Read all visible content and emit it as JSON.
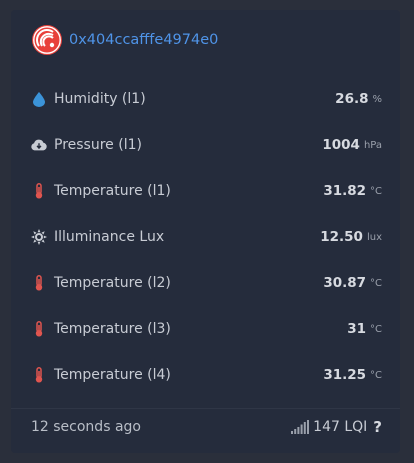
{
  "device": {
    "ieee": "0x404ccafffe4974e0",
    "logo_icon": "espressif-logo-icon"
  },
  "readings": [
    {
      "icon": "water-drop-icon",
      "label": "Humidity (l1)",
      "value": "26.8",
      "unit": "%"
    },
    {
      "icon": "cloud-download-icon",
      "label": "Pressure (l1)",
      "value": "1004",
      "unit": "hPa"
    },
    {
      "icon": "thermometer-icon",
      "label": "Temperature (l1)",
      "value": "31.82",
      "unit": "°C"
    },
    {
      "icon": "sun-icon",
      "label": "Illuminance Lux",
      "value": "12.50",
      "unit": "lux"
    },
    {
      "icon": "thermometer-icon",
      "label": "Temperature (l2)",
      "value": "30.87",
      "unit": "°C"
    },
    {
      "icon": "thermometer-icon",
      "label": "Temperature (l3)",
      "value": "31",
      "unit": "°C"
    },
    {
      "icon": "thermometer-icon",
      "label": "Temperature (l4)",
      "value": "31.25",
      "unit": "°C"
    }
  ],
  "footer": {
    "last_seen": "12 seconds ago",
    "lqi": "147 LQI",
    "help": "?",
    "signal_icon": "signal-bars-icon"
  },
  "colors": {
    "page_bg": "#2a2f3b",
    "card_bg": "#252c3c",
    "link": "#4f94e8",
    "logo_red": "#e8413b",
    "water_blue": "#3b93d8",
    "thermometer_red": "#e0554f",
    "icon_gray": "#c8ccd4"
  }
}
